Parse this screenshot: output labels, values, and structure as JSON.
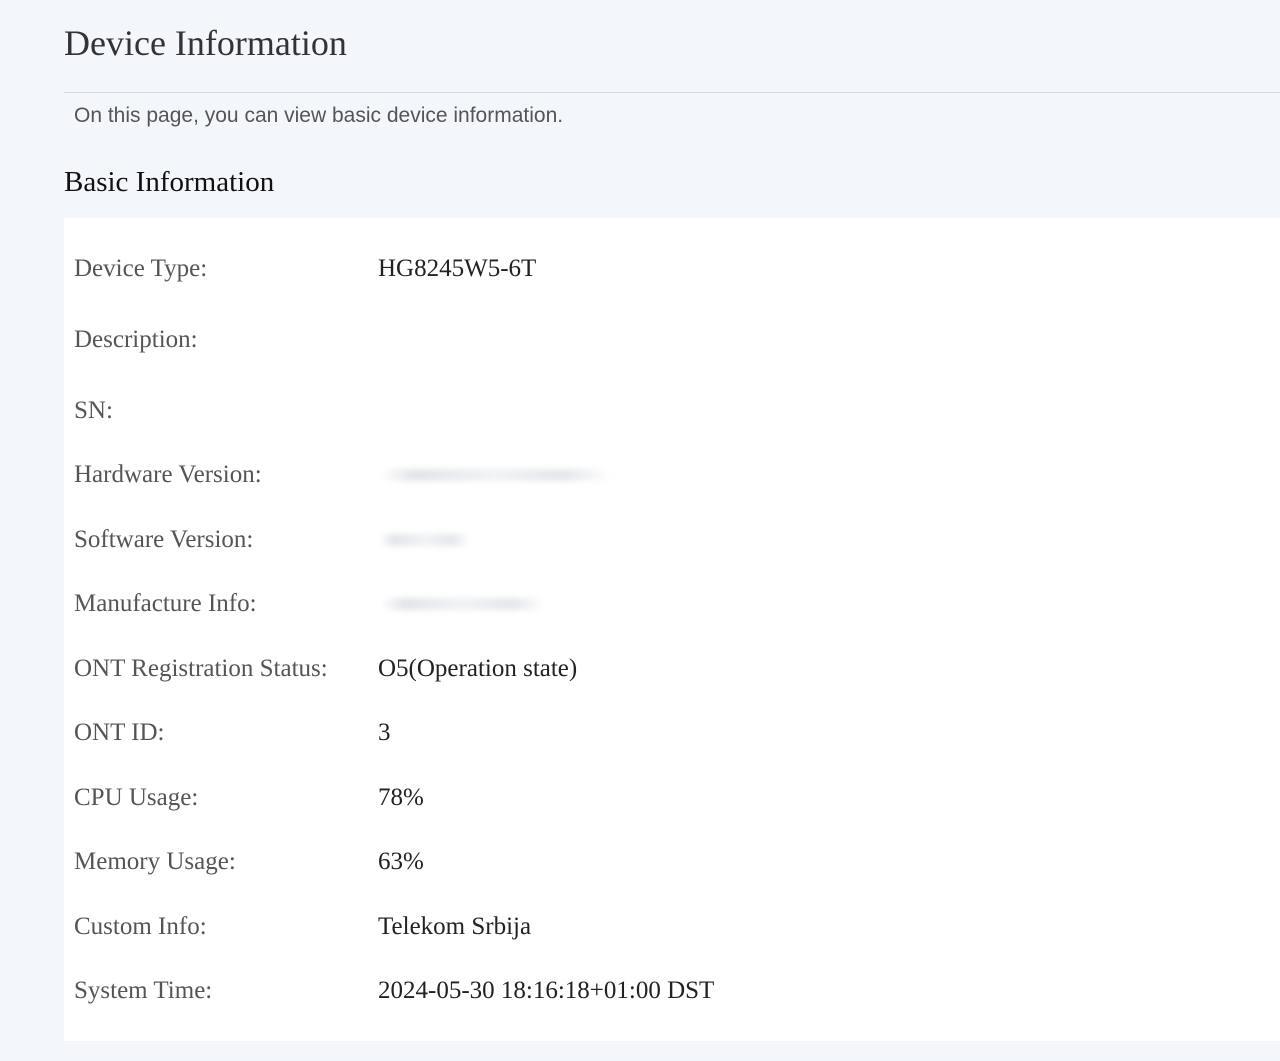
{
  "header": {
    "title": "Device Information",
    "description": "On this page, you can view basic device information."
  },
  "section": {
    "title": "Basic Information"
  },
  "rows": {
    "device_type": {
      "label": "Device Type:",
      "value": "HG8245W5-6T"
    },
    "description": {
      "label": "Description:",
      "value": ""
    },
    "sn": {
      "label": "SN:",
      "value": ""
    },
    "hardware_version": {
      "label": "Hardware Version:",
      "value": ""
    },
    "software_version": {
      "label": "Software Version:",
      "value": ""
    },
    "manufacture_info": {
      "label": "Manufacture Info:",
      "value": ""
    },
    "ont_registration_status": {
      "label": "ONT Registration Status:",
      "value": "O5(Operation state)"
    },
    "ont_id": {
      "label": "ONT ID:",
      "value": "3"
    },
    "cpu_usage": {
      "label": "CPU Usage:",
      "value": "78%"
    },
    "memory_usage": {
      "label": "Memory Usage:",
      "value": "63%"
    },
    "custom_info": {
      "label": "Custom Info:",
      "value": "Telekom Srbija"
    },
    "system_time": {
      "label": "System Time:",
      "value": "2024-05-30 18:16:18+01:00 DST"
    }
  },
  "colors": {
    "page_background": "#f3f7fb",
    "panel_background": "#ffffff",
    "label_text": "#555555",
    "value_text": "#222222"
  }
}
